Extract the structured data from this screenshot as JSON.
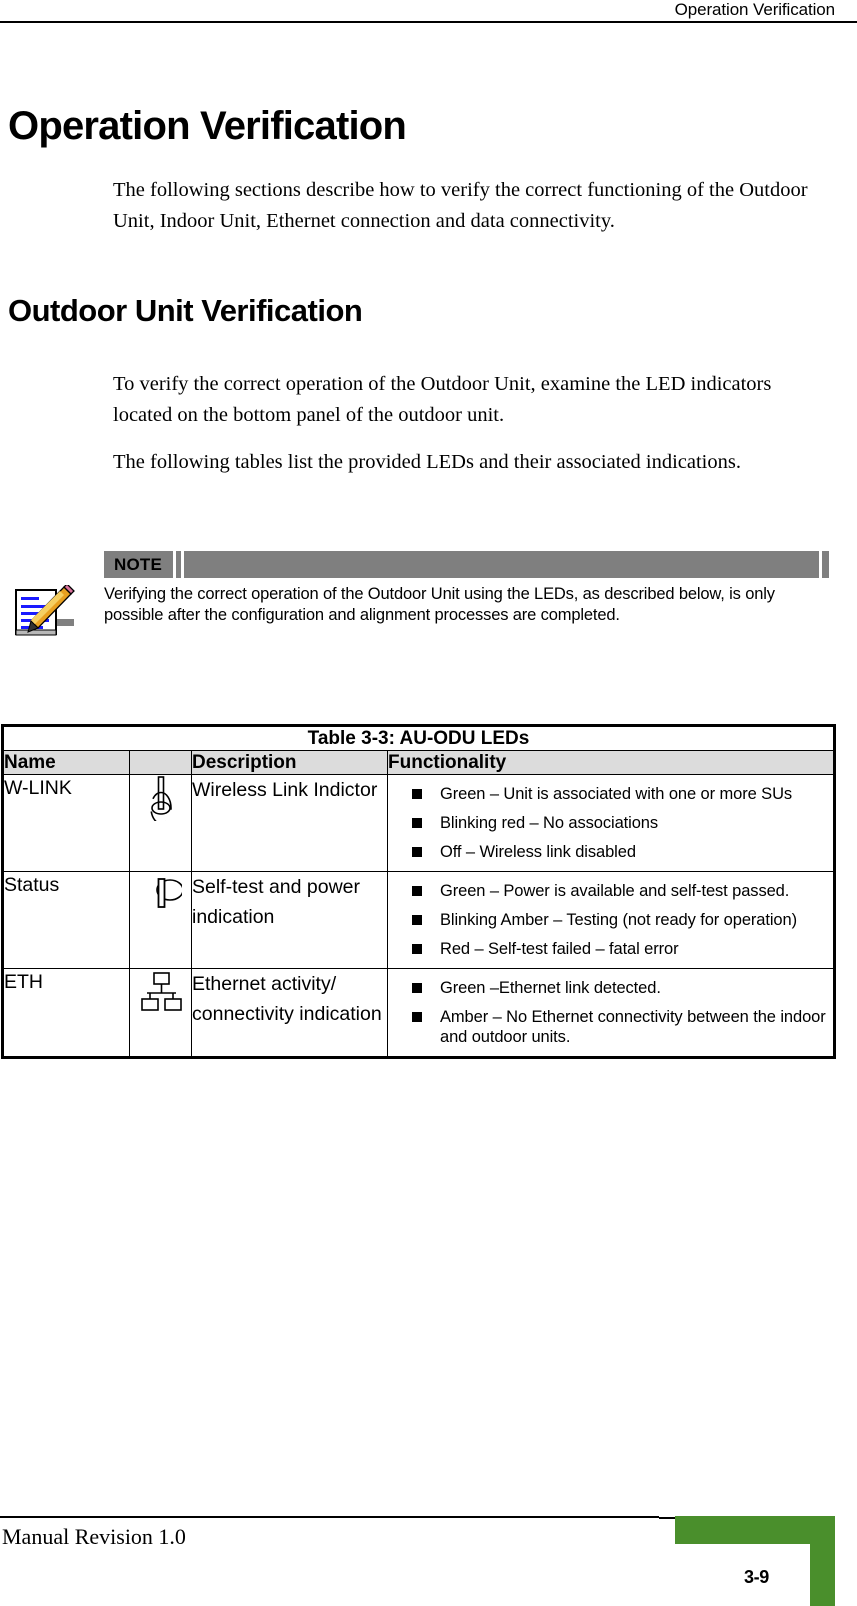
{
  "header": {
    "running_title": "Operation Verification"
  },
  "main": {
    "title": "Operation Verification",
    "intro_paragraph": "The following sections describe how to verify the correct functioning of the Outdoor Unit, Indoor Unit, Ethernet connection and data connectivity.",
    "section_heading": "Outdoor Unit Verification",
    "section_paragraph_1": "To verify the correct operation of the Outdoor Unit, examine the LED indicators located on the bottom panel of the outdoor unit.",
    "section_paragraph_2": "The following tables list the provided LEDs and their associated indications."
  },
  "note": {
    "label": "NOTE",
    "icon": "notepad-pencil-icon",
    "text": "Verifying the correct operation of the Outdoor Unit using the LEDs, as described below, is only possible after the configuration and alignment processes are completed.",
    "bar_color": "#7f7f7f"
  },
  "table": {
    "caption": "Table 3-3: AU-ODU LEDs",
    "columns": [
      "Name",
      "",
      "Description",
      "Functionality"
    ],
    "header_background": "#dcdcdc",
    "rows": [
      {
        "name": "W-LINK",
        "icon": "wireless-antenna-icon",
        "description": "Wireless Link Indictor",
        "functionality": [
          "Green – Unit is associated with one or more SUs",
          "Blinking red – No associations",
          "Off – Wireless link disabled"
        ]
      },
      {
        "name": "Status",
        "icon": "power-symbol-icon",
        "description": "Self-test and power indication",
        "functionality": [
          "Green – Power is available and self-test passed.",
          "Blinking Amber – Testing (not ready for operation)",
          "Red – Self-test failed – fatal error"
        ]
      },
      {
        "name": "ETH",
        "icon": "network-topology-icon",
        "description": "Ethernet activity/ connectivity indication",
        "functionality": [
          "Green –Ethernet link detected.",
          "Amber – No Ethernet connectivity between the indoor and outdoor units."
        ]
      }
    ]
  },
  "footer": {
    "revision": "Manual Revision 1.0",
    "page_number": "3-9",
    "accent_color": "#4a8f2c"
  }
}
